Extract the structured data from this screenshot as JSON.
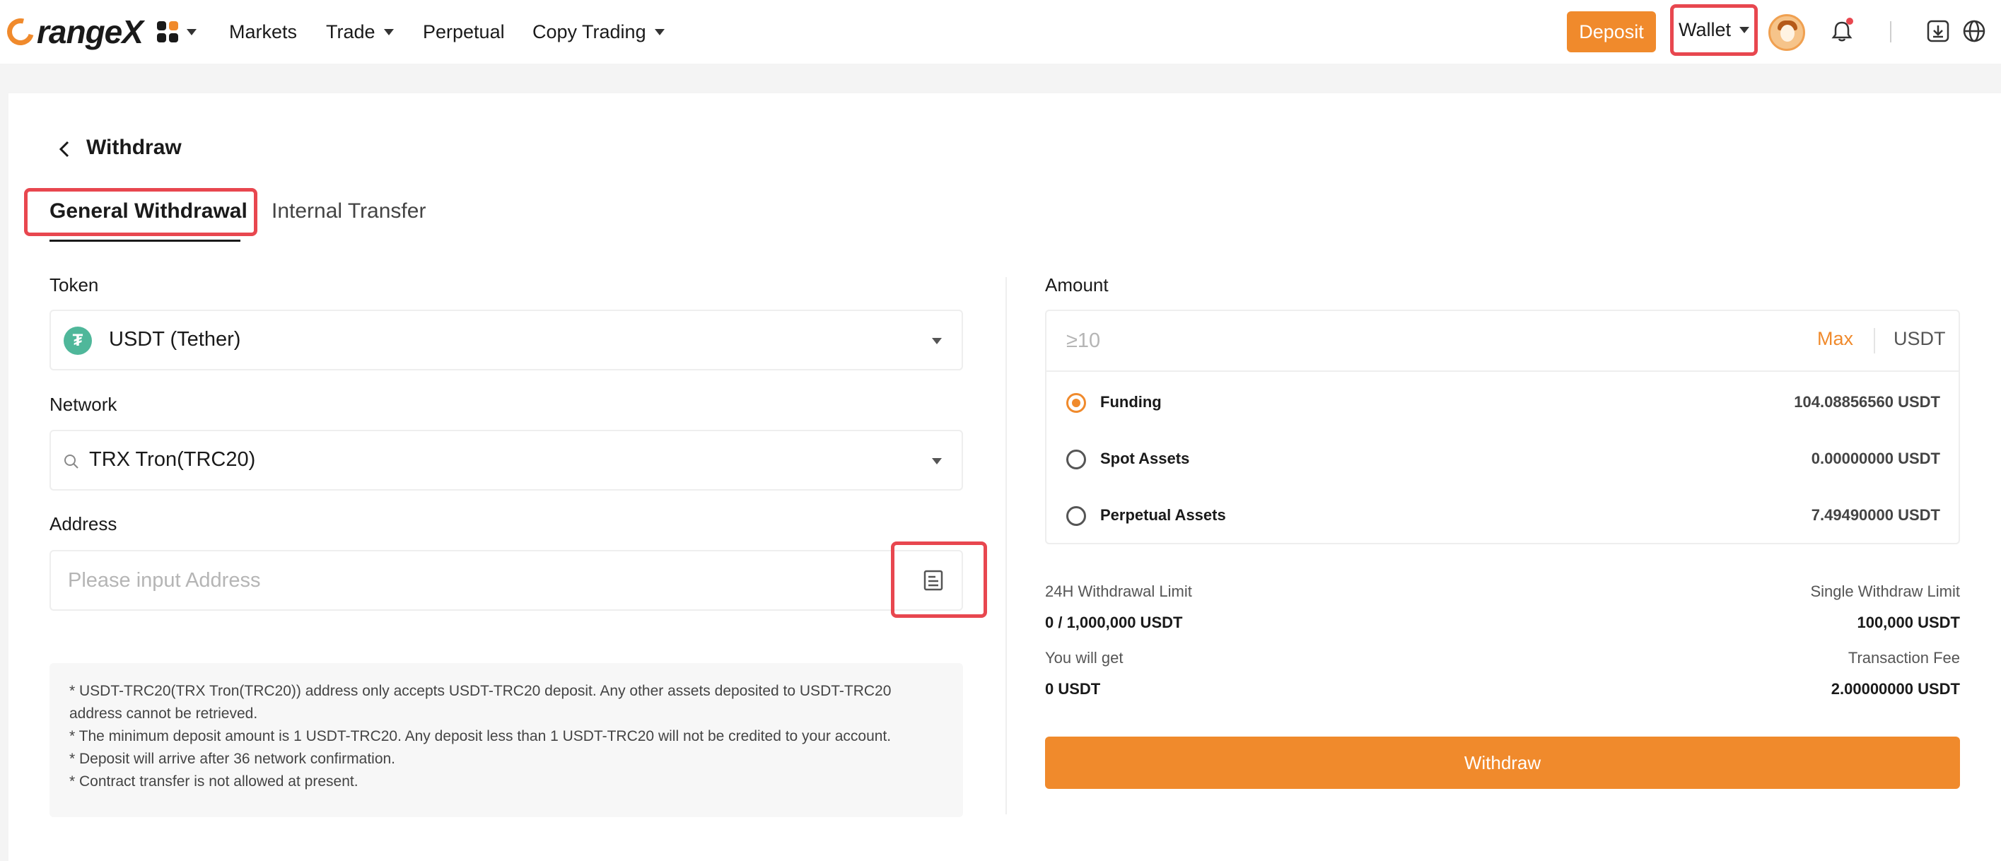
{
  "header": {
    "logo_text": "rangeX",
    "nav": [
      "Markets",
      "Trade",
      "Perpetual",
      "Copy Trading"
    ],
    "deposit_label": "Deposit",
    "wallet_label": "Wallet"
  },
  "page": {
    "title": "Withdraw",
    "tabs": [
      "General Withdrawal",
      "Internal Transfer"
    ]
  },
  "form": {
    "token_label": "Token",
    "token_value": "USDT (Tether)",
    "token_icon_glyph": "₮",
    "network_label": "Network",
    "network_value": "TRX Tron(TRC20)",
    "address_label": "Address",
    "address_placeholder": "Please input Address",
    "notes": [
      "* USDT-TRC20(TRX Tron(TRC20)) address only accepts USDT-TRC20 deposit. Any other assets deposited to USDT-TRC20 address cannot be retrieved.",
      "* The minimum deposit amount is 1 USDT-TRC20. Any deposit less than 1 USDT-TRC20 will not be credited to your account.",
      "* Deposit will arrive after 36 network confirmation.",
      "* Contract transfer is not allowed at present."
    ]
  },
  "amount": {
    "label": "Amount",
    "placeholder": "≥10",
    "max_label": "Max",
    "unit": "USDT",
    "sources": [
      {
        "name": "Funding",
        "value": "104.08856560 USDT",
        "selected": true
      },
      {
        "name": "Spot Assets",
        "value": "0.00000000 USDT",
        "selected": false
      },
      {
        "name": "Perpetual Assets",
        "value": "7.49490000 USDT",
        "selected": false
      }
    ]
  },
  "limits": {
    "limit24_label": "24H Withdrawal Limit",
    "limit24_value": "0 / 1,000,000 USDT",
    "single_label": "Single Withdraw Limit",
    "single_value": "100,000 USDT",
    "get_label": "You will get",
    "get_value": "0 USDT",
    "fee_label": "Transaction Fee",
    "fee_value": "2.00000000 USDT"
  },
  "withdraw_button": "Withdraw",
  "colors": {
    "accent": "#f08a2c",
    "highlight": "#e8474f"
  }
}
